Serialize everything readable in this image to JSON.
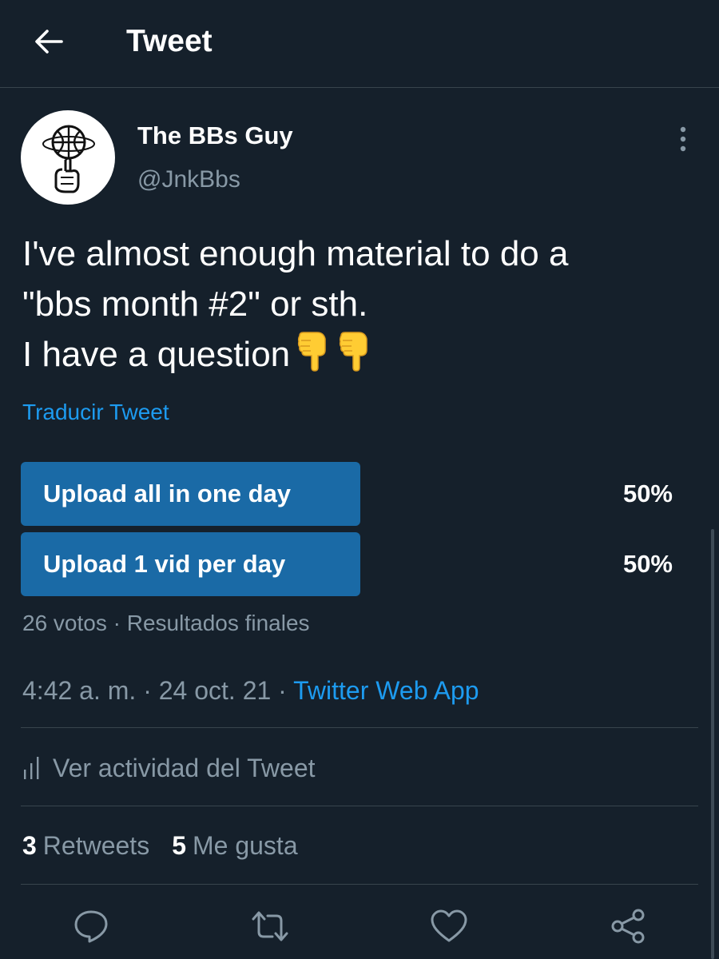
{
  "header": {
    "title": "Tweet",
    "back_icon": "arrow-left-icon"
  },
  "author": {
    "display_name": "The BBs Guy",
    "handle": "@JnkBbs",
    "avatar_icon": "basketball-spinning-finger-icon"
  },
  "tweet": {
    "lines": [
      "I've almost enough material to do a",
      "\"bbs month #2\" or sth.",
      "I have a question"
    ],
    "emoji": [
      "backhand-index-pointing-down-icon",
      "backhand-index-pointing-down-icon"
    ],
    "translate_label": "Traducir Tweet"
  },
  "poll": {
    "options": [
      {
        "label": "Upload all in one day",
        "percent": "50%",
        "fraction": 0.5
      },
      {
        "label": "Upload 1 vid per day",
        "percent": "50%",
        "fraction": 0.5
      }
    ],
    "votes": "26 votos",
    "separator": "·",
    "status": "Resultados finales"
  },
  "meta": {
    "time": "4:42 a. m.",
    "date": "24 oct. 21",
    "separator": "·",
    "source": "Twitter Web App"
  },
  "activity_label": "Ver actividad del Tweet",
  "stats": {
    "retweets_count": "3",
    "retweets_label": "Retweets",
    "likes_count": "5",
    "likes_label": "Me gusta"
  },
  "colors": {
    "background": "#15202b",
    "accent": "#1d9bf0",
    "poll_bar": "#1a6aa6",
    "secondary_text": "#8899a6",
    "divider": "#38444d"
  },
  "actions": [
    "reply-icon",
    "retweet-icon",
    "like-icon",
    "share-icon"
  ]
}
